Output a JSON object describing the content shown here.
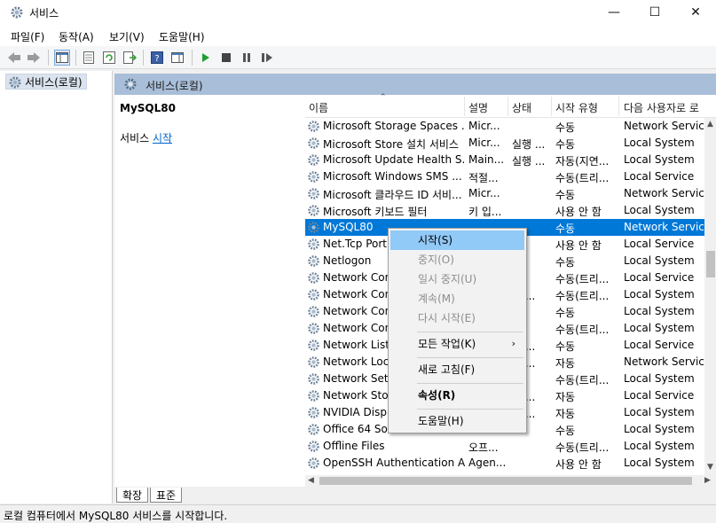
{
  "window": {
    "title": "서비스"
  },
  "menu": [
    "파일(F)",
    "동작(A)",
    "보기(V)",
    "도움말(H)"
  ],
  "tree": {
    "root_label": "서비스(로컬)"
  },
  "panel": {
    "header_title": "서비스(로컬)"
  },
  "description": {
    "service_name": "MySQL80",
    "prefix": "서비스 ",
    "start_link": "시작"
  },
  "columns": {
    "name": "이름",
    "desc": "설명",
    "status": "상태",
    "start_type": "시작 유형",
    "logon": "다음 사용자로 로"
  },
  "rows": [
    {
      "name": "Microsoft Storage Spaces ...",
      "desc": "Micr...",
      "status": "",
      "start": "수동",
      "logon": "Network Service"
    },
    {
      "name": "Microsoft Store 설치 서비스",
      "desc": "Micr...",
      "status": "실행 ...",
      "start": "수동",
      "logon": "Local System"
    },
    {
      "name": "Microsoft Update Health S...",
      "desc": "Main...",
      "status": "실행 ...",
      "start": "자동(지연...",
      "logon": "Local System"
    },
    {
      "name": "Microsoft Windows SMS ...",
      "desc": "적절...",
      "status": "",
      "start": "수동(트리...",
      "logon": "Local Service"
    },
    {
      "name": "Microsoft 클라우드 ID 서비...",
      "desc": "Micr...",
      "status": "",
      "start": "수동",
      "logon": "Network Service"
    },
    {
      "name": "Microsoft 키보드 필터",
      "desc": "키 입...",
      "status": "",
      "start": "사용 안 함",
      "logon": "Local System"
    },
    {
      "name": "MySQL80",
      "desc": "",
      "status": "",
      "start": "수동",
      "logon": "Network Service"
    },
    {
      "name": "Net.Tcp Port",
      "desc": "",
      "status": "",
      "start": "사용 안 함",
      "logon": "Local Service"
    },
    {
      "name": "Netlogon",
      "desc": "",
      "status": "",
      "start": "수동",
      "logon": "Local System"
    },
    {
      "name": "Network Con",
      "desc": "",
      "status": "",
      "start": "수동(트리...",
      "logon": "Local Service"
    },
    {
      "name": "Network Con",
      "desc": "",
      "status": "행 ...",
      "start": "수동(트리...",
      "logon": "Local System"
    },
    {
      "name": "Network Con",
      "desc": "",
      "status": "",
      "start": "수동",
      "logon": "Local System"
    },
    {
      "name": "Network Con",
      "desc": "",
      "status": "",
      "start": "수동(트리...",
      "logon": "Local System"
    },
    {
      "name": "Network List",
      "desc": "",
      "status": "행 ...",
      "start": "수동",
      "logon": "Local Service"
    },
    {
      "name": "Network Loca",
      "desc": "",
      "status": "행 ...",
      "start": "자동",
      "logon": "Network Service"
    },
    {
      "name": "Network Setu",
      "desc": "",
      "status": "",
      "start": "수동(트리...",
      "logon": "Local System"
    },
    {
      "name": "Network Stor",
      "desc": "",
      "status": "행 ...",
      "start": "자동",
      "logon": "Local Service"
    },
    {
      "name": "NVIDIA Displ",
      "desc": "",
      "status": "행 ...",
      "start": "자동",
      "logon": "Local System"
    },
    {
      "name": "Office 64 Sou",
      "desc": "",
      "status": "",
      "start": "수동",
      "logon": "Local System"
    },
    {
      "name": "Offline Files",
      "desc": "오프...",
      "status": "",
      "start": "수동(트리...",
      "logon": "Local System"
    },
    {
      "name": "OpenSSH Authentication A...",
      "desc": "Agen...",
      "status": "",
      "start": "사용 안 함",
      "logon": "Local System"
    }
  ],
  "context_menu": {
    "start": "시작(S)",
    "stop": "중지(O)",
    "pause": "일시 중지(U)",
    "resume": "계속(M)",
    "restart": "다시 시작(E)",
    "all_tasks": "모든 작업(K)",
    "refresh": "새로 고침(F)",
    "properties": "속성(R)",
    "help": "도움말(H)"
  },
  "tabs": {
    "extended": "확장",
    "standard": "표준"
  },
  "status_text": "로컬 컴퓨터에서 MySQL80 서비스를 시작합니다.",
  "colors": {
    "selection": "#0078d7",
    "menu_hover": "#91c9f7",
    "header": "#a9bed8"
  }
}
